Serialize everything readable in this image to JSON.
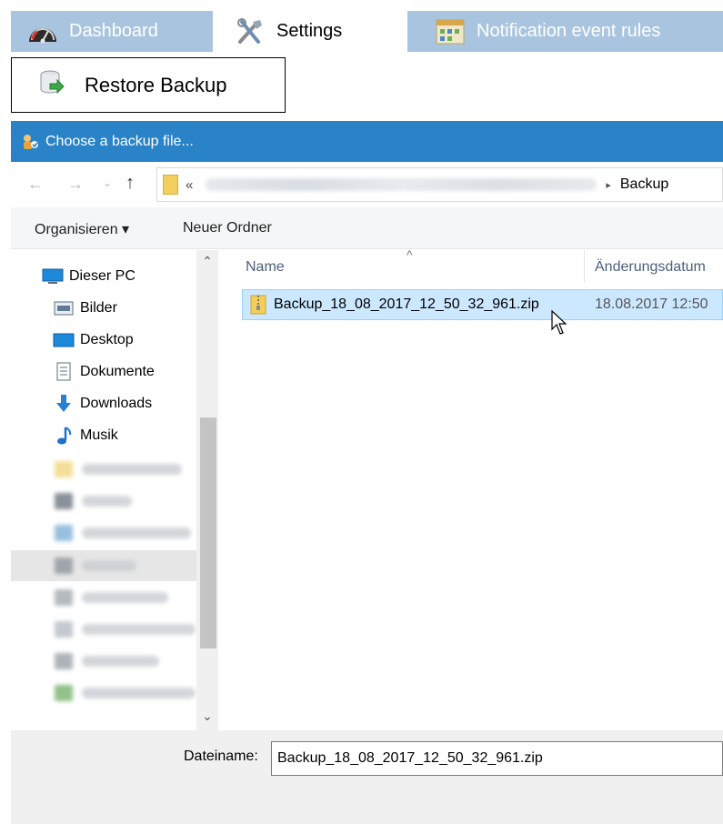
{
  "tabs": [
    {
      "label": "Dashboard",
      "icon": "speedometer-icon"
    },
    {
      "label": "Settings",
      "icon": "tools-icon"
    },
    {
      "label": "Notification event rules",
      "icon": "calendar-icon"
    }
  ],
  "restore": {
    "label": "Restore Backup"
  },
  "dialog": {
    "title": "Choose a backup file..."
  },
  "address": {
    "prefix": "«",
    "crumb": "Backup"
  },
  "commands": {
    "organize": "Organisieren ▾",
    "new_folder": "Neuer Ordner"
  },
  "nav": {
    "items": [
      {
        "label": "Dieser PC"
      },
      {
        "label": "Bilder"
      },
      {
        "label": "Desktop"
      },
      {
        "label": "Dokumente"
      },
      {
        "label": "Downloads"
      },
      {
        "label": "Musik"
      }
    ]
  },
  "files": {
    "columns": {
      "name": "Name",
      "date": "Änderungsdatum"
    },
    "rows": [
      {
        "name": "Backup_18_08_2017_12_50_32_961.zip",
        "date": "18.08.2017 12:50"
      }
    ]
  },
  "filename": {
    "label": "Dateiname:",
    "value": "Backup_18_08_2017_12_50_32_961.zip"
  },
  "colors": {
    "tabbar": "#a9c4df",
    "titlebar": "#2a83c6",
    "selection": "#cce8ff"
  }
}
